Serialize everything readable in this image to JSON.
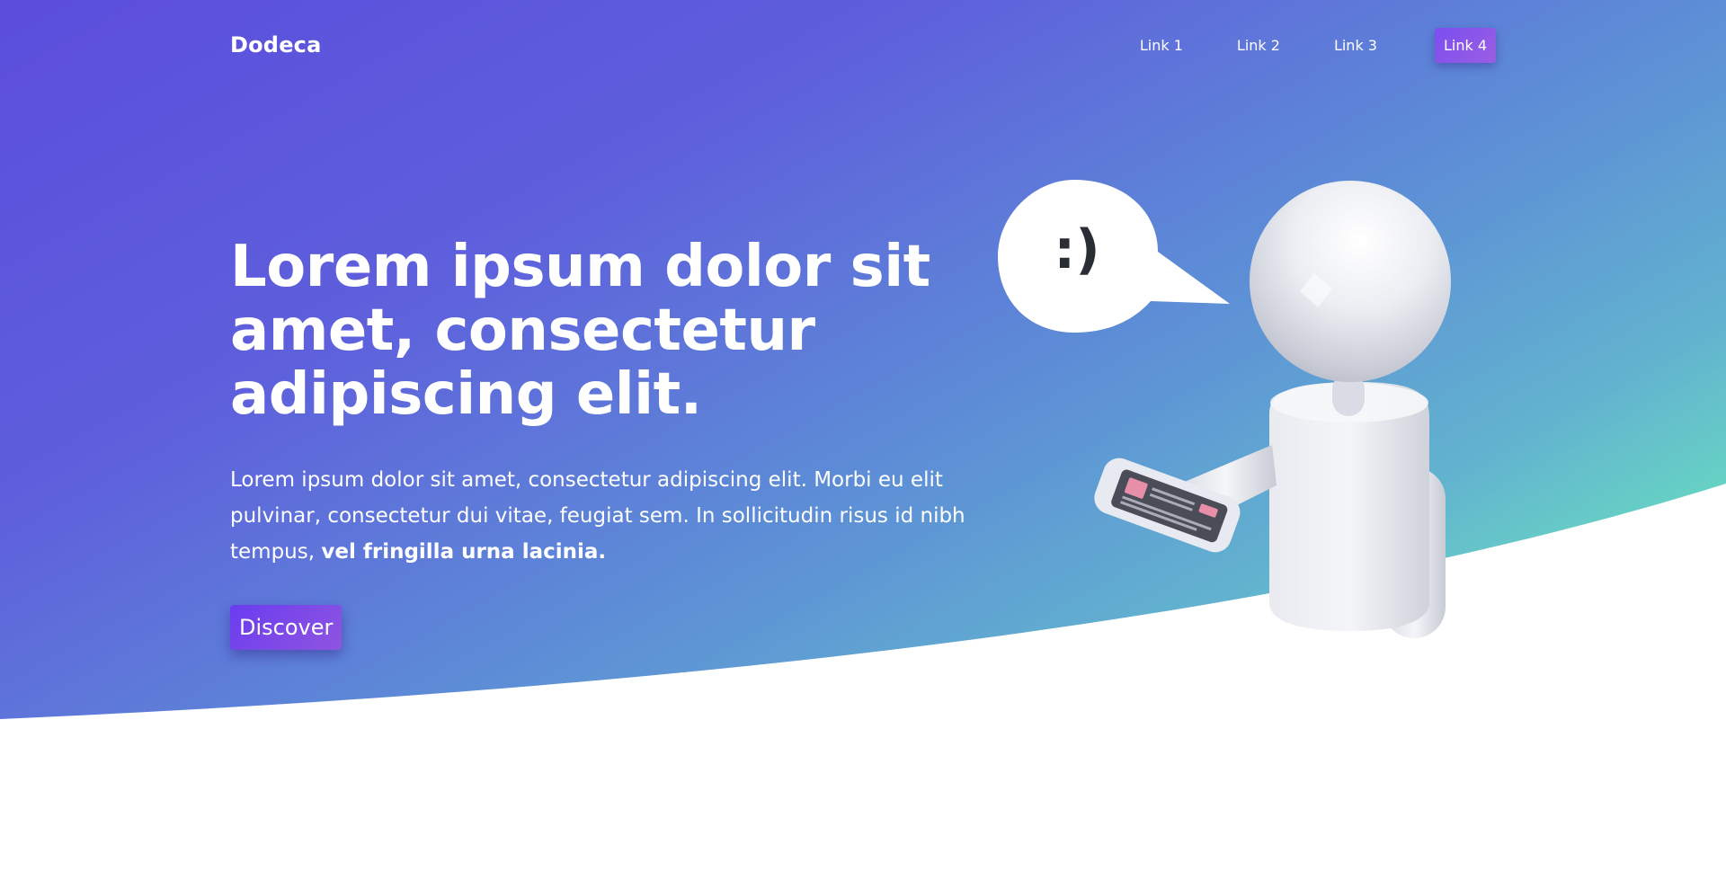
{
  "brand": {
    "name": "Dodeca"
  },
  "nav": {
    "links": [
      {
        "label": "Link 1"
      },
      {
        "label": "Link 2"
      },
      {
        "label": "Link 3"
      },
      {
        "label": "Link 4"
      }
    ]
  },
  "hero": {
    "title": "Lorem ipsum dolor sit amet, consectetur adipiscing elit.",
    "body": "Lorem ipsum dolor sit amet, consectetur adipiscing elit. Morbi eu elit pulvinar, consectetur dui vitae, feugiat sem. In sollicitudin risus id nibh tempus, ",
    "body_bold": "vel fringilla urna lacinia.",
    "button_label": "Discover",
    "speech_bubble": ":)"
  },
  "colors": {
    "gradient_start": "#5b4fdc",
    "gradient_mid": "#5e7fd8",
    "gradient_end": "#66d3c2",
    "accent": "#7b4ef0",
    "background": "#ffffff"
  }
}
